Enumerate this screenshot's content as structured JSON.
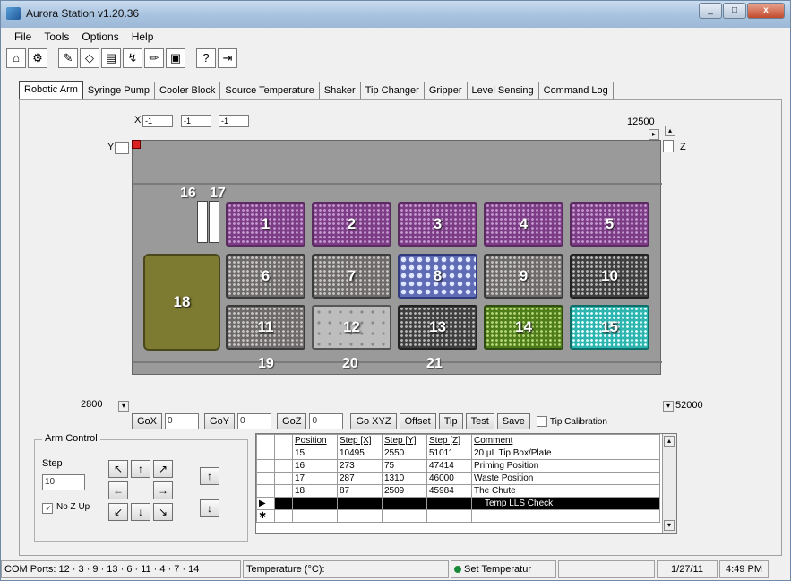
{
  "window": {
    "title": "Aurora Station v1.20.36",
    "close_label": "x"
  },
  "menu": [
    "File",
    "Tools",
    "Options",
    "Help"
  ],
  "toolbar_icons": [
    "home-icon",
    "robot-icon",
    "pipette-icon",
    "eraser-icon",
    "document-icon",
    "dispense-icon",
    "pencil-icon",
    "save-icon",
    "help-icon",
    "exit-icon"
  ],
  "toolbar_glyphs": [
    "⌂",
    "⚙",
    "✎",
    "◇",
    "▤",
    "↯",
    "✏",
    "▣",
    "?",
    "⇥"
  ],
  "tabs": [
    "Robotic Arm",
    "Syringe Pump",
    "Cooler Block",
    "Source Temperature",
    "Shaker",
    "Tip Changer",
    "Gripper",
    "Level Sensing",
    "Command Log"
  ],
  "deck": {
    "x_label": "X",
    "y_label": "Y",
    "z_label": "Z",
    "x_fields": [
      "-1",
      "-1",
      "-1"
    ],
    "x_max": "12500",
    "y_max": "2800",
    "z_max": "52000",
    "positions": [
      "1",
      "2",
      "3",
      "4",
      "5",
      "6",
      "7",
      "8",
      "9",
      "10",
      "11",
      "12",
      "13",
      "14",
      "15",
      "16",
      "17",
      "18",
      "19",
      "20",
      "21"
    ]
  },
  "go": {
    "gox": "GoX",
    "goy": "GoY",
    "goz": "GoZ",
    "goxyz": "Go XYZ",
    "x_value": "0",
    "y_value": "0",
    "z_value": "0",
    "offset": "Offset",
    "tip": "Tip",
    "test": "Test",
    "save": "Save",
    "tip_calibration": "Tip Calibration"
  },
  "arm": {
    "title": "Arm Control",
    "step_label": "Step",
    "step_value": "10",
    "no_z_up": "No Z Up",
    "no_z_up_checked": true
  },
  "grid": {
    "headers": [
      "Position",
      "Step [X]",
      "Step [Y]",
      "Step [Z]",
      "Comment"
    ],
    "rows": [
      [
        "15",
        "10495",
        "2550",
        "51011",
        "20 µL Tip Box/Plate"
      ],
      [
        "16",
        "273",
        "75",
        "47414",
        "Priming Position"
      ],
      [
        "17",
        "287",
        "1310",
        "46000",
        "Waste Position"
      ],
      [
        "18",
        "87",
        "2509",
        "45984",
        "The Chute"
      ],
      [
        "",
        "",
        "",
        "",
        "Temp LLS Check"
      ]
    ]
  },
  "status": {
    "ports": "COM Ports: 12 · 3 · 9 · 13 · 6 · 11 · 4 · 7 · 14",
    "temperature": "Temperature (°C):",
    "set_temp": "Set Temperatur",
    "date": "1/27/11",
    "time": "4:49 PM"
  }
}
